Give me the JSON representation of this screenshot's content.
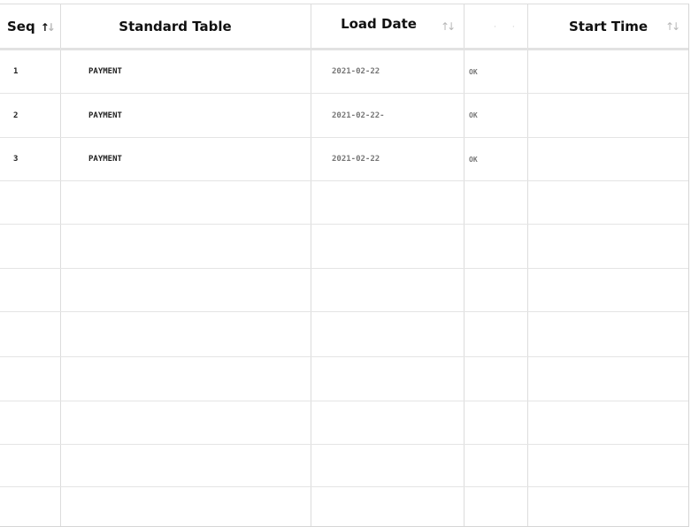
{
  "table": {
    "headers": {
      "seq": "Seq",
      "standard_table": "Standard Table",
      "load_date": "Load Date",
      "status": "",
      "start_time": "Start Time"
    },
    "sort": {
      "active_column": "Seq",
      "direction": "ascending"
    },
    "rows": [
      {
        "seq": "1",
        "standard_table": "PAYMENT",
        "load_date": "2021-02-22",
        "status": "OK",
        "start_time": ""
      },
      {
        "seq": "2",
        "standard_table": "PAYMENT",
        "load_date": "2021-02-22-",
        "status": "OK",
        "start_time": ""
      },
      {
        "seq": "3",
        "standard_table": "PAYMENT",
        "load_date": "2021-02-22",
        "status": "OK",
        "start_time": ""
      }
    ]
  },
  "icons": {
    "sort": "sort-arrows-icon"
  },
  "colors": {
    "grid_line": "#dcdcdc",
    "header_text": "#111111",
    "muted_text": "#777777",
    "sort_inactive": "#b8b8b8"
  }
}
